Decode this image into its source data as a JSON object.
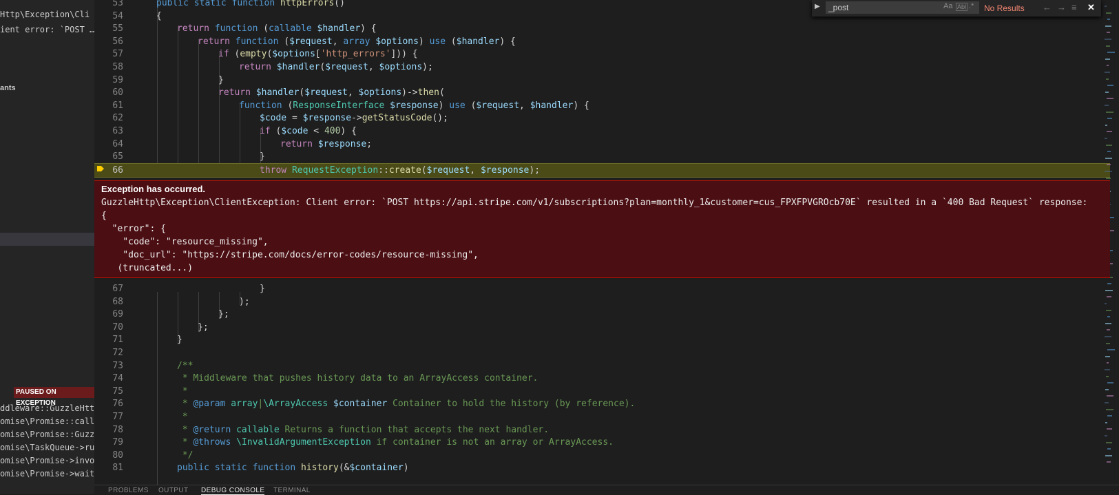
{
  "sidebar": {
    "top_lines": [
      "Http\\Exception\\Cli",
      "ient error: `POST …"
    ],
    "section_label": "ants",
    "paused_badge": "PAUSED ON EXCEPTION",
    "stack_frames": [
      "ddleware::GuzzleHttp",
      "omise\\Promise::callH",
      "omise\\Promise::Guzzl",
      "omise\\TaskQueue->run",
      "omise\\Promise->invok",
      "omise\\Promise->wait"
    ]
  },
  "find": {
    "value": "_post",
    "opt_case": "Aa",
    "opt_word": "Abl",
    "opt_regex": ".*",
    "status": "No Results",
    "prev": "←",
    "next": "→",
    "selection": "≡",
    "close": "✕"
  },
  "editor": {
    "current_line": "66",
    "lines_top": [
      {
        "n": "53",
        "segs": [
          {
            "c": "k",
            "t": "public static function "
          },
          {
            "c": "f",
            "t": "httpErrors"
          },
          {
            "c": "p",
            "t": "()"
          }
        ]
      },
      {
        "n": "54",
        "segs": [
          {
            "c": "p",
            "t": "{"
          }
        ]
      },
      {
        "n": "55",
        "segs": [
          {
            "c": "c",
            "t": "return "
          },
          {
            "c": "k",
            "t": "function "
          },
          {
            "c": "p",
            "t": "("
          },
          {
            "c": "k",
            "t": "callable "
          },
          {
            "c": "v",
            "t": "$handler"
          },
          {
            "c": "p",
            "t": ") {"
          }
        ]
      },
      {
        "n": "56",
        "segs": [
          {
            "c": "c",
            "t": "return "
          },
          {
            "c": "k",
            "t": "function "
          },
          {
            "c": "p",
            "t": "("
          },
          {
            "c": "v",
            "t": "$request"
          },
          {
            "c": "p",
            "t": ", "
          },
          {
            "c": "k",
            "t": "array "
          },
          {
            "c": "v",
            "t": "$options"
          },
          {
            "c": "p",
            "t": ") "
          },
          {
            "c": "k",
            "t": "use "
          },
          {
            "c": "p",
            "t": "("
          },
          {
            "c": "v",
            "t": "$handler"
          },
          {
            "c": "p",
            "t": ") {"
          }
        ]
      },
      {
        "n": "57",
        "segs": [
          {
            "c": "c",
            "t": "if "
          },
          {
            "c": "p",
            "t": "("
          },
          {
            "c": "f",
            "t": "empty"
          },
          {
            "c": "p",
            "t": "("
          },
          {
            "c": "v",
            "t": "$options"
          },
          {
            "c": "p",
            "t": "["
          },
          {
            "c": "s",
            "t": "'http_errors'"
          },
          {
            "c": "p",
            "t": "])) {"
          }
        ]
      },
      {
        "n": "58",
        "segs": [
          {
            "c": "c",
            "t": "return "
          },
          {
            "c": "v",
            "t": "$handler"
          },
          {
            "c": "p",
            "t": "("
          },
          {
            "c": "v",
            "t": "$request"
          },
          {
            "c": "p",
            "t": ", "
          },
          {
            "c": "v",
            "t": "$options"
          },
          {
            "c": "p",
            "t": ");"
          }
        ]
      },
      {
        "n": "59",
        "segs": [
          {
            "c": "p",
            "t": "}"
          }
        ]
      },
      {
        "n": "60",
        "segs": [
          {
            "c": "c",
            "t": "return "
          },
          {
            "c": "v",
            "t": "$handler"
          },
          {
            "c": "p",
            "t": "("
          },
          {
            "c": "v",
            "t": "$request"
          },
          {
            "c": "p",
            "t": ", "
          },
          {
            "c": "v",
            "t": "$options"
          },
          {
            "c": "p",
            "t": ")->"
          },
          {
            "c": "f",
            "t": "then"
          },
          {
            "c": "p",
            "t": "("
          }
        ]
      },
      {
        "n": "61",
        "segs": [
          {
            "c": "k",
            "t": "function "
          },
          {
            "c": "p",
            "t": "("
          },
          {
            "c": "t",
            "t": "ResponseInterface "
          },
          {
            "c": "v",
            "t": "$response"
          },
          {
            "c": "p",
            "t": ") "
          },
          {
            "c": "k",
            "t": "use "
          },
          {
            "c": "p",
            "t": "("
          },
          {
            "c": "v",
            "t": "$request"
          },
          {
            "c": "p",
            "t": ", "
          },
          {
            "c": "v",
            "t": "$handler"
          },
          {
            "c": "p",
            "t": ") {"
          }
        ]
      },
      {
        "n": "62",
        "segs": [
          {
            "c": "v",
            "t": "$code"
          },
          {
            "c": "p",
            "t": " = "
          },
          {
            "c": "v",
            "t": "$response"
          },
          {
            "c": "p",
            "t": "->"
          },
          {
            "c": "f",
            "t": "getStatusCode"
          },
          {
            "c": "p",
            "t": "();"
          }
        ]
      },
      {
        "n": "63",
        "segs": [
          {
            "c": "c",
            "t": "if "
          },
          {
            "c": "p",
            "t": "("
          },
          {
            "c": "v",
            "t": "$code"
          },
          {
            "c": "p",
            "t": " < "
          },
          {
            "c": "n",
            "t": "400"
          },
          {
            "c": "p",
            "t": ") {"
          }
        ]
      },
      {
        "n": "64",
        "segs": [
          {
            "c": "c",
            "t": "return "
          },
          {
            "c": "v",
            "t": "$response"
          },
          {
            "c": "p",
            "t": ";"
          }
        ]
      },
      {
        "n": "65",
        "segs": [
          {
            "c": "p",
            "t": "}"
          }
        ]
      },
      {
        "n": "66",
        "segs": [
          {
            "c": "c",
            "t": "throw "
          },
          {
            "c": "t",
            "t": "RequestException"
          },
          {
            "c": "p",
            "t": "::"
          },
          {
            "c": "f",
            "t": "create"
          },
          {
            "c": "p",
            "t": "("
          },
          {
            "c": "v",
            "t": "$request"
          },
          {
            "c": "p",
            "t": ", "
          },
          {
            "c": "v",
            "t": "$response"
          },
          {
            "c": "p",
            "t": ");"
          }
        ]
      }
    ],
    "lines_bottom": [
      {
        "n": "67",
        "segs": [
          {
            "c": "p",
            "t": "}"
          }
        ]
      },
      {
        "n": "68",
        "segs": [
          {
            "c": "p",
            "t": ");"
          }
        ]
      },
      {
        "n": "69",
        "segs": [
          {
            "c": "p",
            "t": "};"
          }
        ]
      },
      {
        "n": "70",
        "segs": [
          {
            "c": "p",
            "t": "};"
          }
        ]
      },
      {
        "n": "71",
        "segs": [
          {
            "c": "p",
            "t": "}"
          }
        ]
      },
      {
        "n": "72",
        "segs": []
      },
      {
        "n": "73",
        "segs": [
          {
            "c": "cm",
            "t": "/**"
          }
        ]
      },
      {
        "n": "74",
        "segs": [
          {
            "c": "cm",
            "t": " * Middleware that pushes history data to an ArrayAccess container."
          }
        ]
      },
      {
        "n": "75",
        "segs": [
          {
            "c": "cm",
            "t": " *"
          }
        ]
      },
      {
        "n": "76",
        "segs": [
          {
            "c": "cm",
            "t": " * "
          },
          {
            "c": "k",
            "t": "@param "
          },
          {
            "c": "t",
            "t": "array"
          },
          {
            "c": "cm",
            "t": "|"
          },
          {
            "c": "t",
            "t": "\\ArrayAccess "
          },
          {
            "c": "v",
            "t": "$container"
          },
          {
            "c": "cm",
            "t": " Container to hold the history (by reference)."
          }
        ]
      },
      {
        "n": "77",
        "segs": [
          {
            "c": "cm",
            "t": " *"
          }
        ]
      },
      {
        "n": "78",
        "segs": [
          {
            "c": "cm",
            "t": " * "
          },
          {
            "c": "k",
            "t": "@return "
          },
          {
            "c": "t",
            "t": "callable"
          },
          {
            "c": "cm",
            "t": " Returns a function that accepts the next handler."
          }
        ]
      },
      {
        "n": "79",
        "segs": [
          {
            "c": "cm",
            "t": " * "
          },
          {
            "c": "k",
            "t": "@throws "
          },
          {
            "c": "t",
            "t": "\\InvalidArgumentException"
          },
          {
            "c": "cm",
            "t": " if container is not an array or ArrayAccess."
          }
        ]
      },
      {
        "n": "80",
        "segs": [
          {
            "c": "cm",
            "t": " */"
          }
        ]
      },
      {
        "n": "81",
        "segs": [
          {
            "c": "k",
            "t": "public static function "
          },
          {
            "c": "f",
            "t": "history"
          },
          {
            "c": "p",
            "t": "(&"
          },
          {
            "c": "v",
            "t": "$container"
          },
          {
            "c": "p",
            "t": ")"
          }
        ]
      }
    ]
  },
  "exception": {
    "title": "Exception has occurred.",
    "lines": [
      "GuzzleHttp\\Exception\\ClientException: Client error: `POST https://api.stripe.com/v1/subscriptions?plan=monthly_1&customer=cus_FPXFPVGROcb70E` resulted in a `400 Bad Request` response:",
      "{",
      "  \"error\": {",
      "    \"code\": \"resource_missing\",",
      "    \"doc_url\": \"https://stripe.com/docs/error-codes/resource-missing\",",
      "   (truncated...)"
    ]
  },
  "panel": {
    "tabs": [
      {
        "label": "PROBLEMS",
        "active": false
      },
      {
        "label": "OUTPUT",
        "active": false
      },
      {
        "label": "DEBUG CONSOLE",
        "active": true
      },
      {
        "label": "TERMINAL",
        "active": false
      }
    ]
  },
  "colors": {
    "exception_bg": "#4b0e13",
    "exception_border": "#be1100",
    "current_line_bg": "#4b4b18",
    "no_results": "#f48771"
  }
}
